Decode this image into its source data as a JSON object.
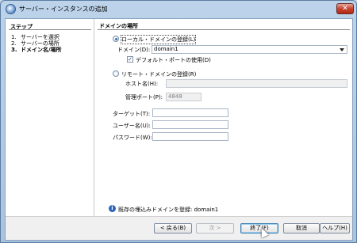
{
  "window": {
    "title": "サーバー・インスタンスの追加",
    "close_glyph": "✕"
  },
  "steps": {
    "heading": "ステップ",
    "items": [
      {
        "num": "1.",
        "label": "サーバーを選択"
      },
      {
        "num": "2.",
        "label": "サーバーの場所"
      },
      {
        "num": "3.",
        "label": "ドメイン名/場所"
      }
    ]
  },
  "main": {
    "heading": "ドメインの場所",
    "local_radio_label": "ローカル・ドメインの登録(L)",
    "domain_label": "ドメイン(D):",
    "domain_value": "domain1",
    "default_port_checkbox_label": "デフォルト・ポートの使用(D)",
    "default_port_check_glyph": "✓",
    "remote_radio_label": "リモート・ドメインの登録(R)",
    "host_label": "ホスト名(H):",
    "host_value": "",
    "admin_port_label": "管理ポート(P):",
    "admin_port_value": "4848",
    "target_label": "ターゲット(T):",
    "username_label": "ユーザー名(U):",
    "password_label": "パスワード(W):",
    "info_icon_glyph": "i",
    "info_message": "既存の埋込みドメインを登録: domain1"
  },
  "buttons": {
    "back": "< 戻る(B)",
    "next": "次 >",
    "finish": "終了(F)",
    "cancel": "取消",
    "help": "ヘルプ(H)"
  }
}
